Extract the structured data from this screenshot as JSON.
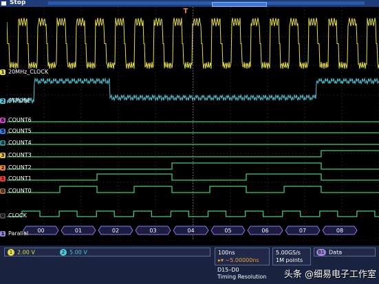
{
  "status": {
    "run_state": "Stop"
  },
  "channels": {
    "ch1": {
      "name": "20MHz_CLOCK",
      "number": "1",
      "color": "#e8e03c"
    },
    "ch2": {
      "name": "STROBE",
      "number": "2",
      "color": "#4ec8d8"
    }
  },
  "digital": [
    {
      "name": "COUNT6",
      "number": "6",
      "color": "#cc44cc"
    },
    {
      "name": "COUNT5",
      "number": "5",
      "color": "#3c78e8"
    },
    {
      "name": "COUNT4",
      "number": "4",
      "color": "#2e8a8a"
    },
    {
      "name": "COUNT3",
      "number": "3",
      "color": "#e8c83c"
    },
    {
      "name": "COUNT2",
      "number": "2",
      "color": "#e88a3c"
    },
    {
      "name": "COUNT1",
      "number": "1",
      "color": "#e83c3c"
    },
    {
      "name": "COUNT0",
      "number": "0",
      "color": "#a06a3c"
    },
    {
      "name": "CLOCK",
      "number": "0",
      "color": "#4a4a4a"
    }
  ],
  "bus": {
    "label": "Parallel",
    "number": "B1",
    "values": [
      "00",
      "01",
      "02",
      "03",
      "04",
      "05",
      "06",
      "07",
      "08"
    ]
  },
  "readouts": {
    "ch1_scale": "2.00 V",
    "ch2_scale": "5.00 V",
    "ch1_num": "1",
    "ch2_num": "2",
    "timebase": "100ns",
    "position": "~5.00000ns",
    "sample_rate": "5.00GS/s",
    "record_length": "1M points",
    "bus_id": "B1",
    "bus_type": "Data",
    "digital_group": "D15–D0",
    "timing_resolution": "Timing Resolution"
  },
  "watermark": "头条 @细易电子工作室",
  "trigger_marker": "T"
}
